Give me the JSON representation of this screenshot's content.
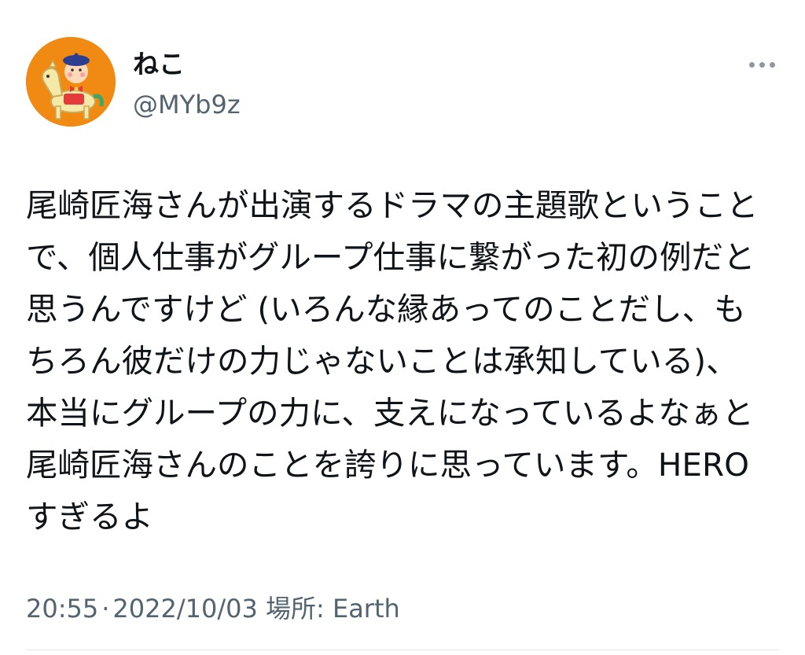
{
  "author": {
    "display_name": "ねこ",
    "handle": "@MYb9z",
    "avatar_icon": "cartoon-child-riding-horse-avatar"
  },
  "more_icon": "more-dots-icon",
  "tweet": {
    "lines": [
      "尾崎匠海さんが出演するドラマの主題歌ということ",
      "で、個人仕事がグループ仕事に繋がった初の例だと",
      "思うんですけど (いろんな縁あってのことだし、も",
      "ちろん彼だけの力じゃないことは承知している)、",
      "本当にグループの力に、支えになっているよなぁと",
      "尾崎匠海さんのことを誇りに思っています。HERO",
      "すぎるよ"
    ]
  },
  "meta": {
    "time": "20:55",
    "separator": "·",
    "date": "2022/10/03",
    "location_label": "場所:",
    "location": "Earth"
  },
  "colors": {
    "text_primary": "#0f1419",
    "text_secondary": "#536471",
    "avatar_bg": "#f08a12",
    "divider": "#e1e8ed"
  }
}
